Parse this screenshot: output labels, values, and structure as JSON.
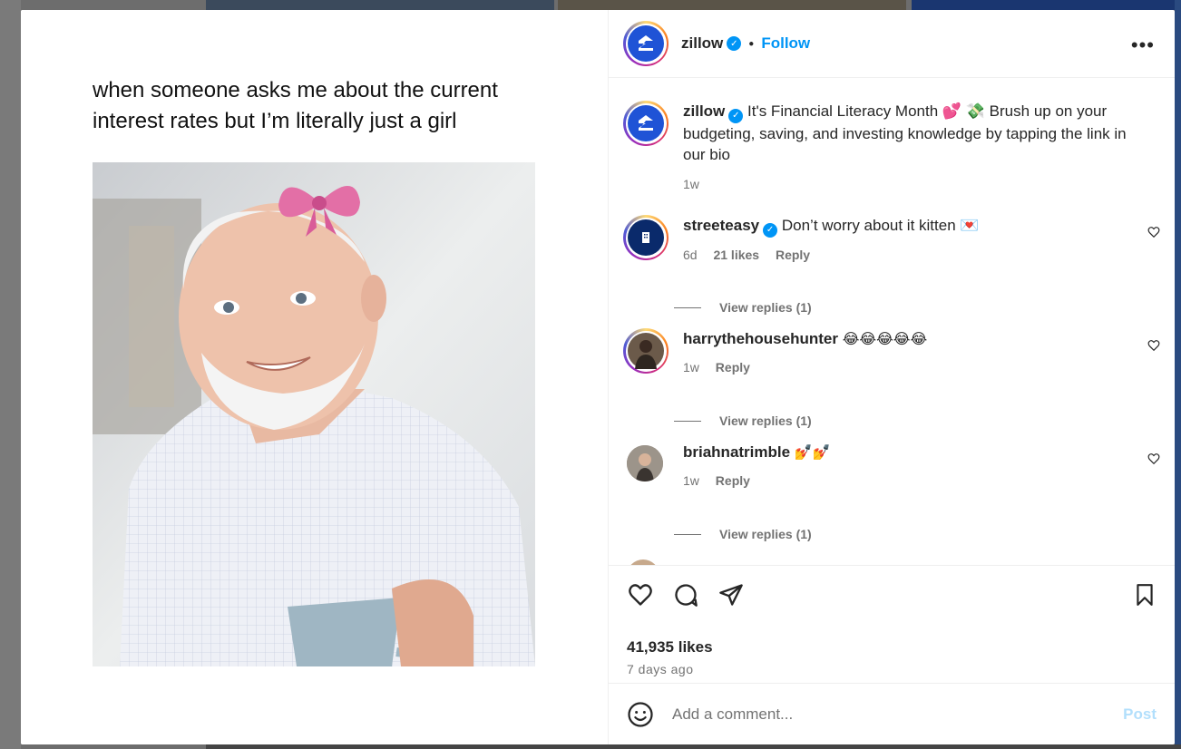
{
  "post": {
    "meme_caption": "when someone asks me about the current interest rates but I’m literally just a girl",
    "author": "zillow",
    "follow_label": "Follow",
    "more_label": "•••",
    "caption_author": "zillow",
    "caption_text": "It's Financial Literacy Month 💕 💸 Brush up on your budgeting, saving, and investing knowledge by tapping the link in our bio",
    "caption_time": "1w",
    "likes": "41,935 likes",
    "posted": "7 days ago"
  },
  "comments": [
    {
      "user": "streeteasy",
      "verified": true,
      "text": "Don’t worry about it kitten 💌",
      "time": "6d",
      "likes": "21 likes",
      "reply": "Reply",
      "replies": "View replies (1)"
    },
    {
      "user": "harrythehousehunter",
      "verified": false,
      "text": "😂😂😂😂😂",
      "time": "1w",
      "reply": "Reply",
      "replies": "View replies (1)"
    },
    {
      "user": "briahnatrimble",
      "verified": false,
      "text": "💅💅",
      "time": "1w",
      "reply": "Reply",
      "replies": "View replies (1)"
    }
  ],
  "composer": {
    "placeholder": "Add a comment...",
    "post_label": "Post"
  },
  "colors": {
    "accent": "#0095f6",
    "zillow_blue": "#1f53d6"
  }
}
